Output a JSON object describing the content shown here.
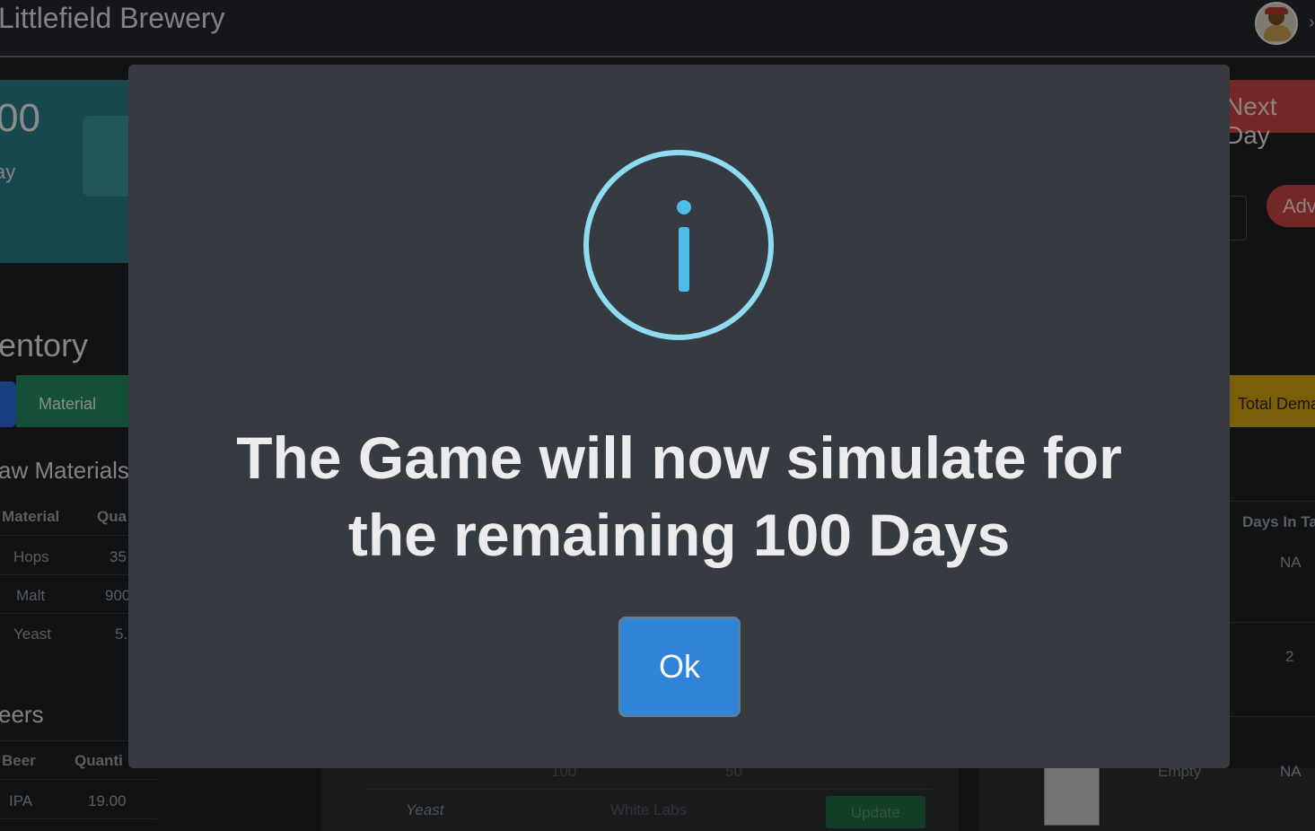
{
  "app": {
    "brand": "Littlefield Brewery"
  },
  "dashboard": {
    "day_value": "00",
    "day_label": "ay",
    "inventory_title": "entory",
    "material_tab": "Material",
    "raw_materials_title": "aw Materials",
    "raw_table": {
      "headers": [
        "Material",
        "Qua"
      ],
      "rows": [
        [
          "Hops",
          "35"
        ],
        [
          "Malt",
          "900"
        ],
        [
          "Yeast",
          "5."
        ]
      ]
    },
    "beers_title": "eers",
    "beer_table": {
      "headers": [
        "Beer",
        "Quanti"
      ],
      "rows": [
        [
          "IPA",
          "19.00"
        ]
      ]
    },
    "next_day_label": "Next Day",
    "advance_label": "Adva",
    "total_demand_label": "Total Dema",
    "tank_table": {
      "header": "Days In Ta",
      "values": [
        "NA",
        "2",
        "NA"
      ],
      "empty_label": "Empty"
    },
    "mid_panel": {
      "values": [
        "100",
        "50"
      ],
      "yeast_label": "Yeast",
      "yeast_supplier": "White Labs",
      "update_label": "Update"
    }
  },
  "modal": {
    "icon": "info-icon",
    "line1": "The Game will now simulate for",
    "line2": "the remaining 100 Days",
    "ok_label": "Ok",
    "colors": {
      "ring": "#8fdcf2",
      "glyph": "#4bbde6",
      "button": "#2e84d8",
      "background": "#363a41"
    }
  }
}
